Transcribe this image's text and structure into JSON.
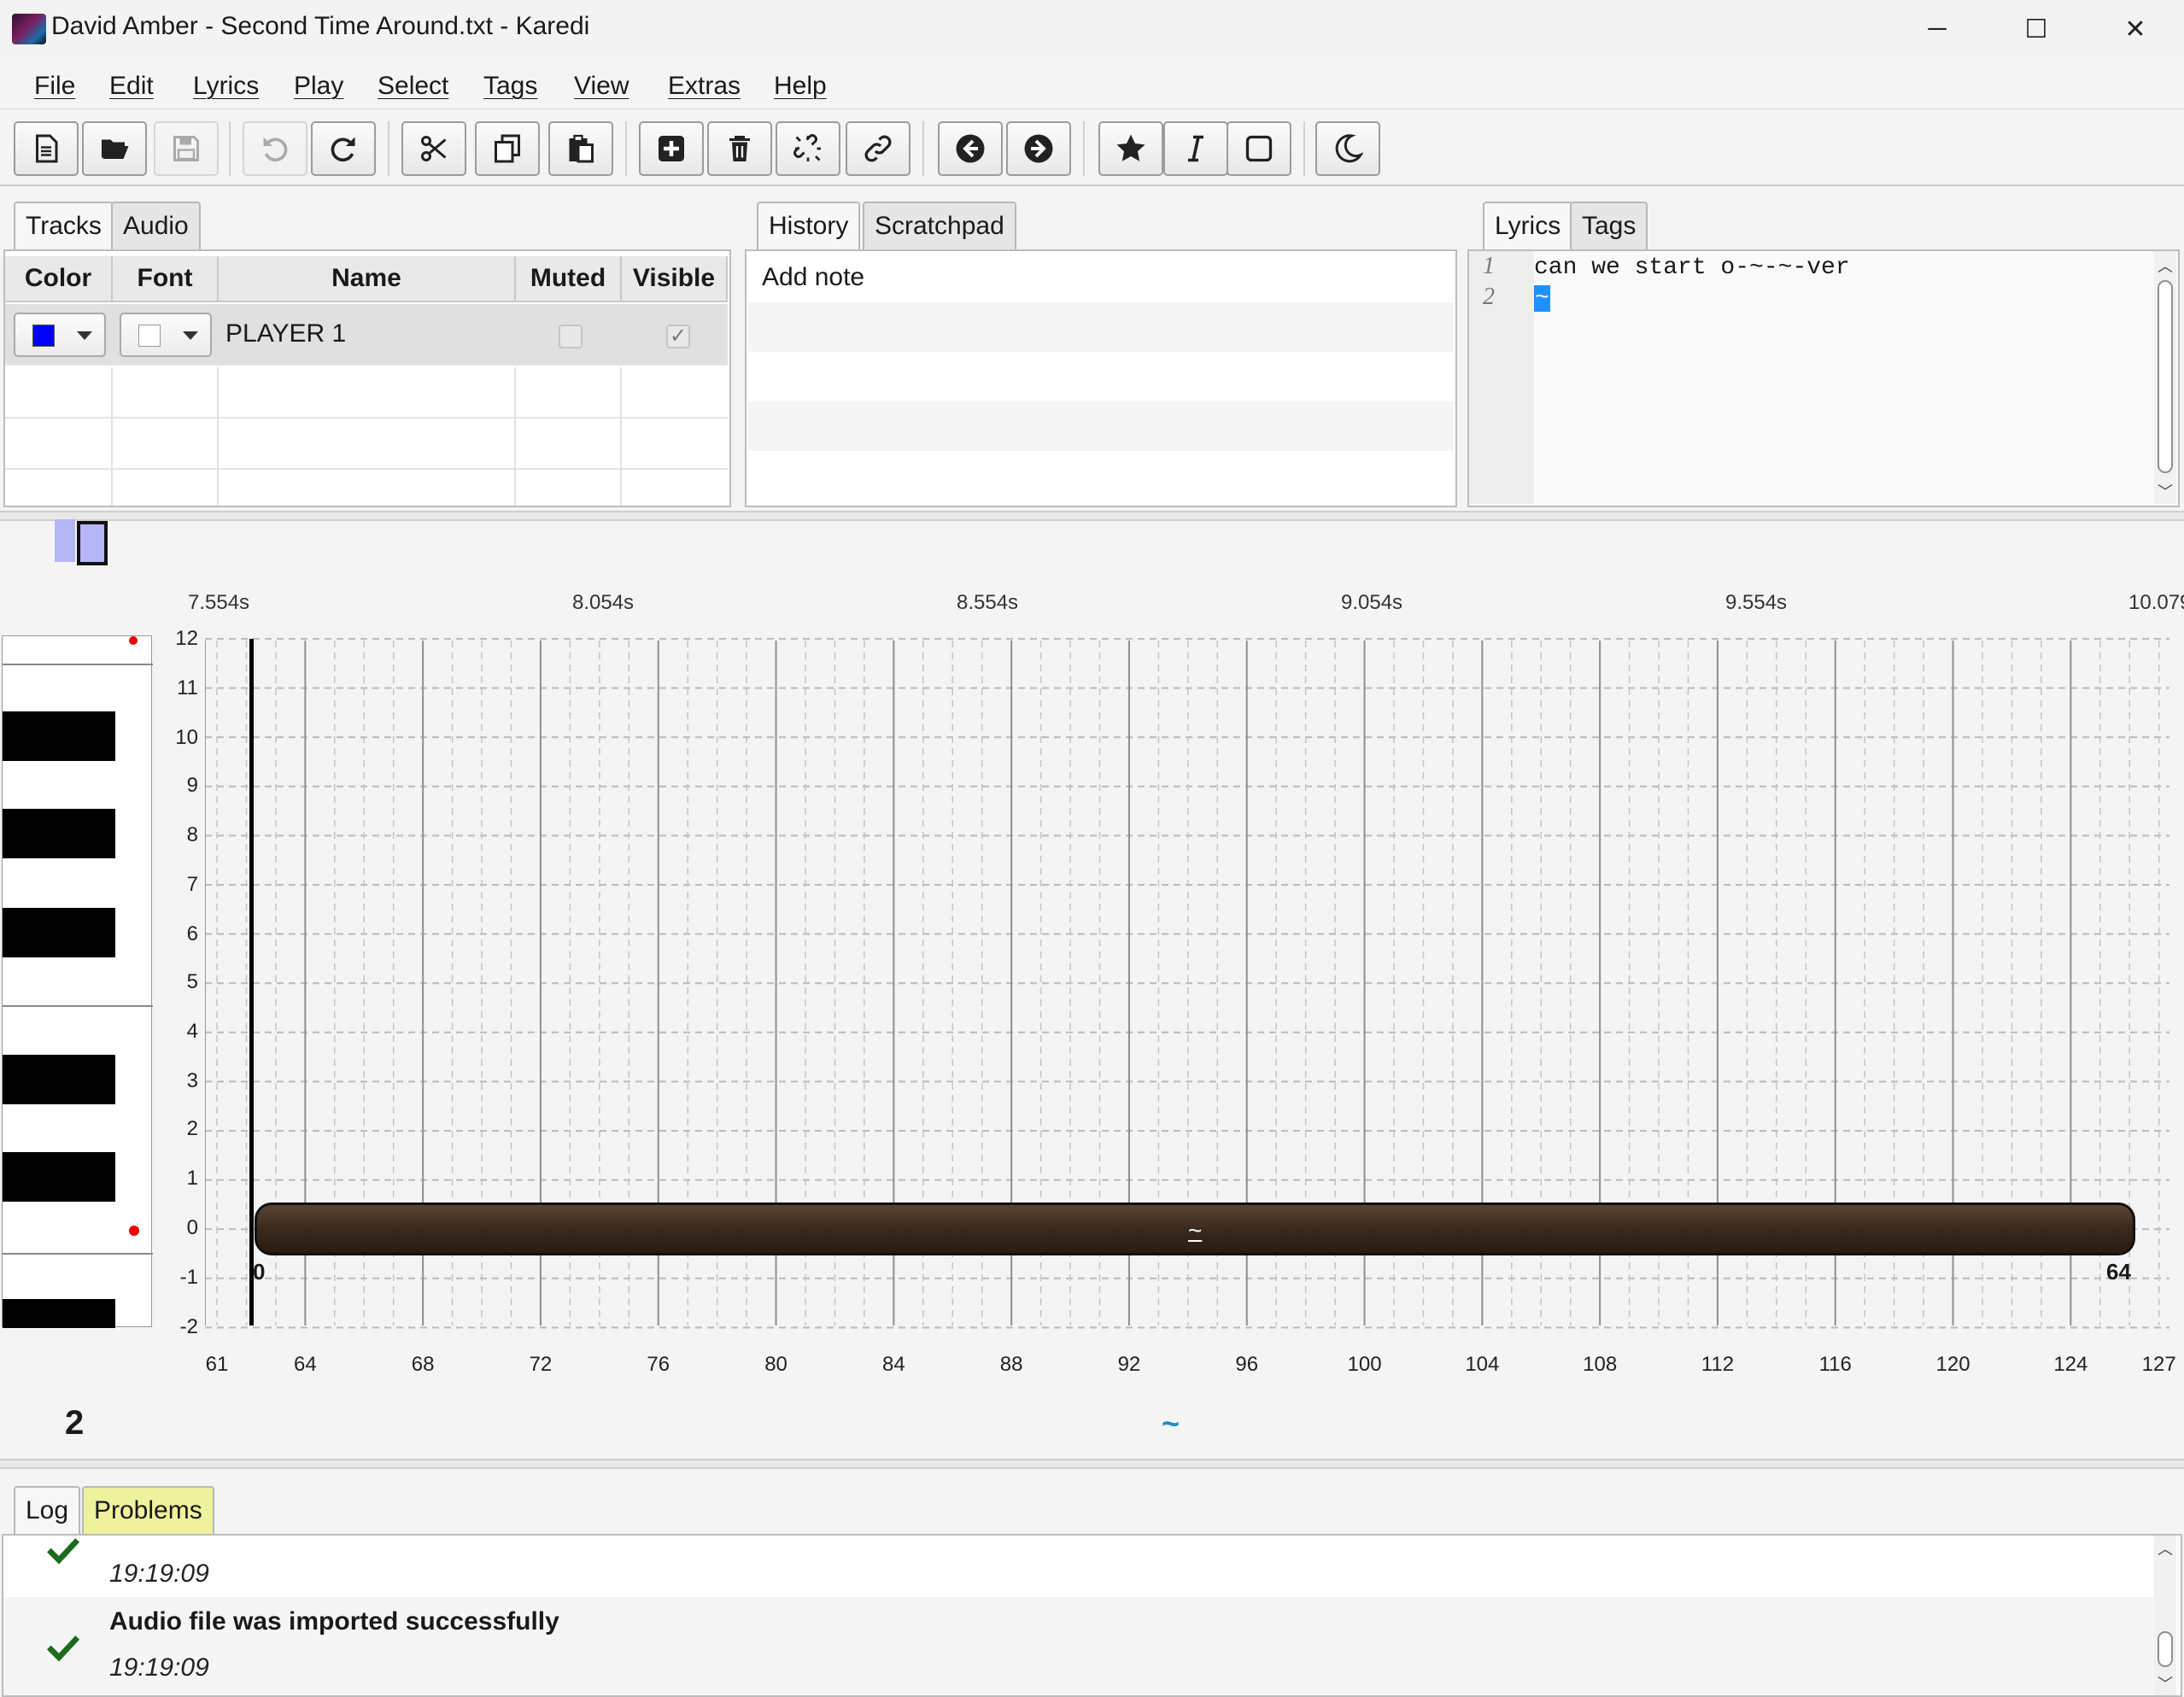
{
  "window": {
    "title": "David Amber - Second Time Around.txt - Karedi",
    "controls": [
      "─",
      "☐",
      "✕"
    ]
  },
  "menu": [
    "File",
    "Edit",
    "Lyrics",
    "Play",
    "Select",
    "Tags",
    "View",
    "Extras",
    "Help"
  ],
  "toolbar": {
    "buttons": [
      "new-file",
      "open-file",
      "save-file",
      "undo",
      "redo",
      "cut",
      "copy",
      "paste",
      "add",
      "delete",
      "split",
      "join",
      "previous",
      "next",
      "golden-note",
      "freestyle",
      "normal-note",
      "dark-mode"
    ]
  },
  "tracks_panel": {
    "tabs": [
      "Tracks",
      "Audio"
    ],
    "columns": [
      "Color",
      "Font",
      "Name",
      "Muted",
      "Visible"
    ],
    "rows": [
      {
        "color": "#0000ff",
        "font_color": "#ffffff",
        "name": "PLAYER 1",
        "muted": false,
        "visible": true
      }
    ]
  },
  "history_panel": {
    "tabs": [
      "History",
      "Scratchpad"
    ],
    "items": [
      "Add note"
    ]
  },
  "lyrics_panel": {
    "tabs": [
      "Lyrics",
      "Tags"
    ],
    "lines": [
      {
        "num": "1",
        "text": "can we start o-~-~-ver"
      },
      {
        "num": "2",
        "text": "~"
      }
    ]
  },
  "editor": {
    "time_labels": [
      "7.554s",
      "8.054s",
      "8.554s",
      "9.054s",
      "9.554s",
      "10.079"
    ],
    "pitch_labels": [
      "12",
      "11",
      "10",
      "9",
      "8",
      "7",
      "6",
      "5",
      "4",
      "3",
      "2",
      "1",
      "0",
      "-1",
      "-2"
    ],
    "beat_labels": [
      "61",
      "64",
      "68",
      "72",
      "76",
      "80",
      "84",
      "88",
      "92",
      "96",
      "100",
      "104",
      "108",
      "112",
      "116",
      "120",
      "124",
      "127"
    ],
    "note": {
      "lyric": "~",
      "start_label": "0",
      "end_label": "64",
      "pitch": 0,
      "color": "#3d2b1f"
    },
    "line_number": "2",
    "line_text": "~"
  },
  "log_panel": {
    "tabs": [
      "Log",
      "Problems"
    ],
    "entries": [
      {
        "message": "",
        "time": "19:19:09"
      },
      {
        "message": "Audio file was imported successfully",
        "time": "19:19:09"
      }
    ]
  }
}
